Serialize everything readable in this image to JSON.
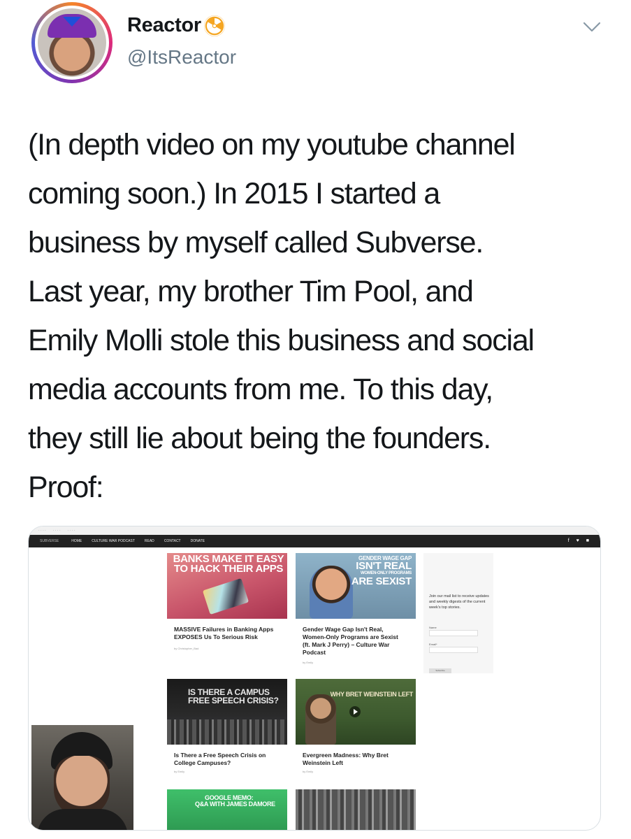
{
  "user": {
    "display_name": "Reactor",
    "verified_badge_icon": "radioactive-icon",
    "handle": "@ItsReactor"
  },
  "tweet": {
    "lines": [
      "(In depth video on my youtube channel",
      "coming soon.) In 2015 I started a",
      "business by myself called Subverse.",
      "Last year, my brother Tim Pool, and",
      "Emily Molli stole this business and social",
      "media accounts from me. To this day,",
      "they still lie about being the founders.",
      "Proof:"
    ]
  },
  "screenshot": {
    "nav": {
      "logo": "SUBVERSE",
      "items": [
        "HOME",
        "CULTURE WAR PODCAST",
        "READ",
        "CONTACT",
        "DONATE"
      ]
    },
    "cards": [
      {
        "thumb_title": "BANKS MAKE IT EASY TO HACK THEIR APPS",
        "title": "MASSIVE Failures in Banking Apps EXPOSES Us To Serious Risk",
        "meta": "by Christopher_Bad"
      },
      {
        "thumb_title_1": "GENDER WAGE GAP",
        "thumb_title_2": "ISN'T REAL",
        "thumb_title_3": "WOMEN-ONLY PROGRAMS",
        "thumb_title_4": "ARE SEXIST",
        "title": "Gender Wage Gap Isn't Real, Women-Only Programs are Sexist (ft. Mark J Perry) – Culture War Podcast",
        "meta": "by Emily"
      },
      {
        "thumb_title_1": "IS THERE A CAMPUS",
        "thumb_title_2": "FREE SPEECH CRISIS?",
        "title": "Is There a Free Speech Crisis on College Campuses?",
        "meta": "by Emily"
      },
      {
        "thumb_title": "WHY BRET WEINSTEIN LEFT",
        "title": "Evergreen Madness: Why Bret Weinstein Left",
        "meta": "by Emily"
      },
      {
        "thumb_title_1": "GOOGLE MEMO:",
        "thumb_title_2": "Q&A WITH JAMES DAMORE"
      }
    ],
    "sidebar": {
      "text": "Join our mail list to receive updates and weekly digests of the current week's top stories.",
      "name_label": "Name",
      "email_label": "Email*",
      "button": "Subscribe"
    }
  },
  "colors": {
    "text": "#14171a",
    "handle": "#657786",
    "avatar_ring_from": "#f58529",
    "avatar_ring_to": "#8134af",
    "badge": "#f5a623"
  }
}
